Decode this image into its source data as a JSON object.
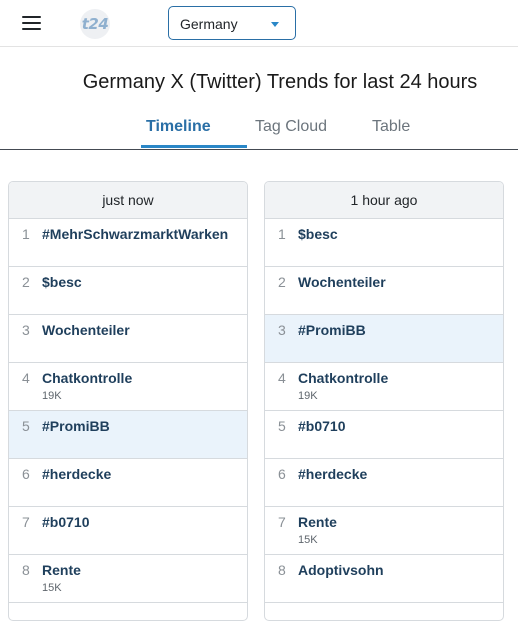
{
  "header": {
    "logo_text": "t24",
    "country_selected": "Germany"
  },
  "title": "Germany X (Twitter) Trends for last 24 hours",
  "tabs": [
    {
      "label": "Timeline",
      "active": true
    },
    {
      "label": "Tag Cloud",
      "active": false
    },
    {
      "label": "Table",
      "active": false
    }
  ],
  "columns": [
    {
      "header": "just now",
      "rows": [
        {
          "rank": "1",
          "name": "#MehrSchwarzmarktWarken",
          "count": "",
          "highlight": false
        },
        {
          "rank": "2",
          "name": "$besc",
          "count": "",
          "highlight": false
        },
        {
          "rank": "3",
          "name": "Wochenteiler",
          "count": "",
          "highlight": false
        },
        {
          "rank": "4",
          "name": "Chatkontrolle",
          "count": "19K",
          "highlight": false
        },
        {
          "rank": "5",
          "name": "#PromiBB",
          "count": "",
          "highlight": true
        },
        {
          "rank": "6",
          "name": "#herdecke",
          "count": "",
          "highlight": false
        },
        {
          "rank": "7",
          "name": "#b0710",
          "count": "",
          "highlight": false
        },
        {
          "rank": "8",
          "name": "Rente",
          "count": "15K",
          "highlight": false
        }
      ]
    },
    {
      "header": "1 hour ago",
      "rows": [
        {
          "rank": "1",
          "name": "$besc",
          "count": "",
          "highlight": false
        },
        {
          "rank": "2",
          "name": "Wochenteiler",
          "count": "",
          "highlight": false
        },
        {
          "rank": "3",
          "name": "#PromiBB",
          "count": "",
          "highlight": true
        },
        {
          "rank": "4",
          "name": "Chatkontrolle",
          "count": "19K",
          "highlight": false
        },
        {
          "rank": "5",
          "name": "#b0710",
          "count": "",
          "highlight": false
        },
        {
          "rank": "6",
          "name": "#herdecke",
          "count": "",
          "highlight": false
        },
        {
          "rank": "7",
          "name": "Rente",
          "count": "15K",
          "highlight": false
        },
        {
          "rank": "8",
          "name": "Adoptivsohn",
          "count": "",
          "highlight": false
        }
      ]
    }
  ]
}
